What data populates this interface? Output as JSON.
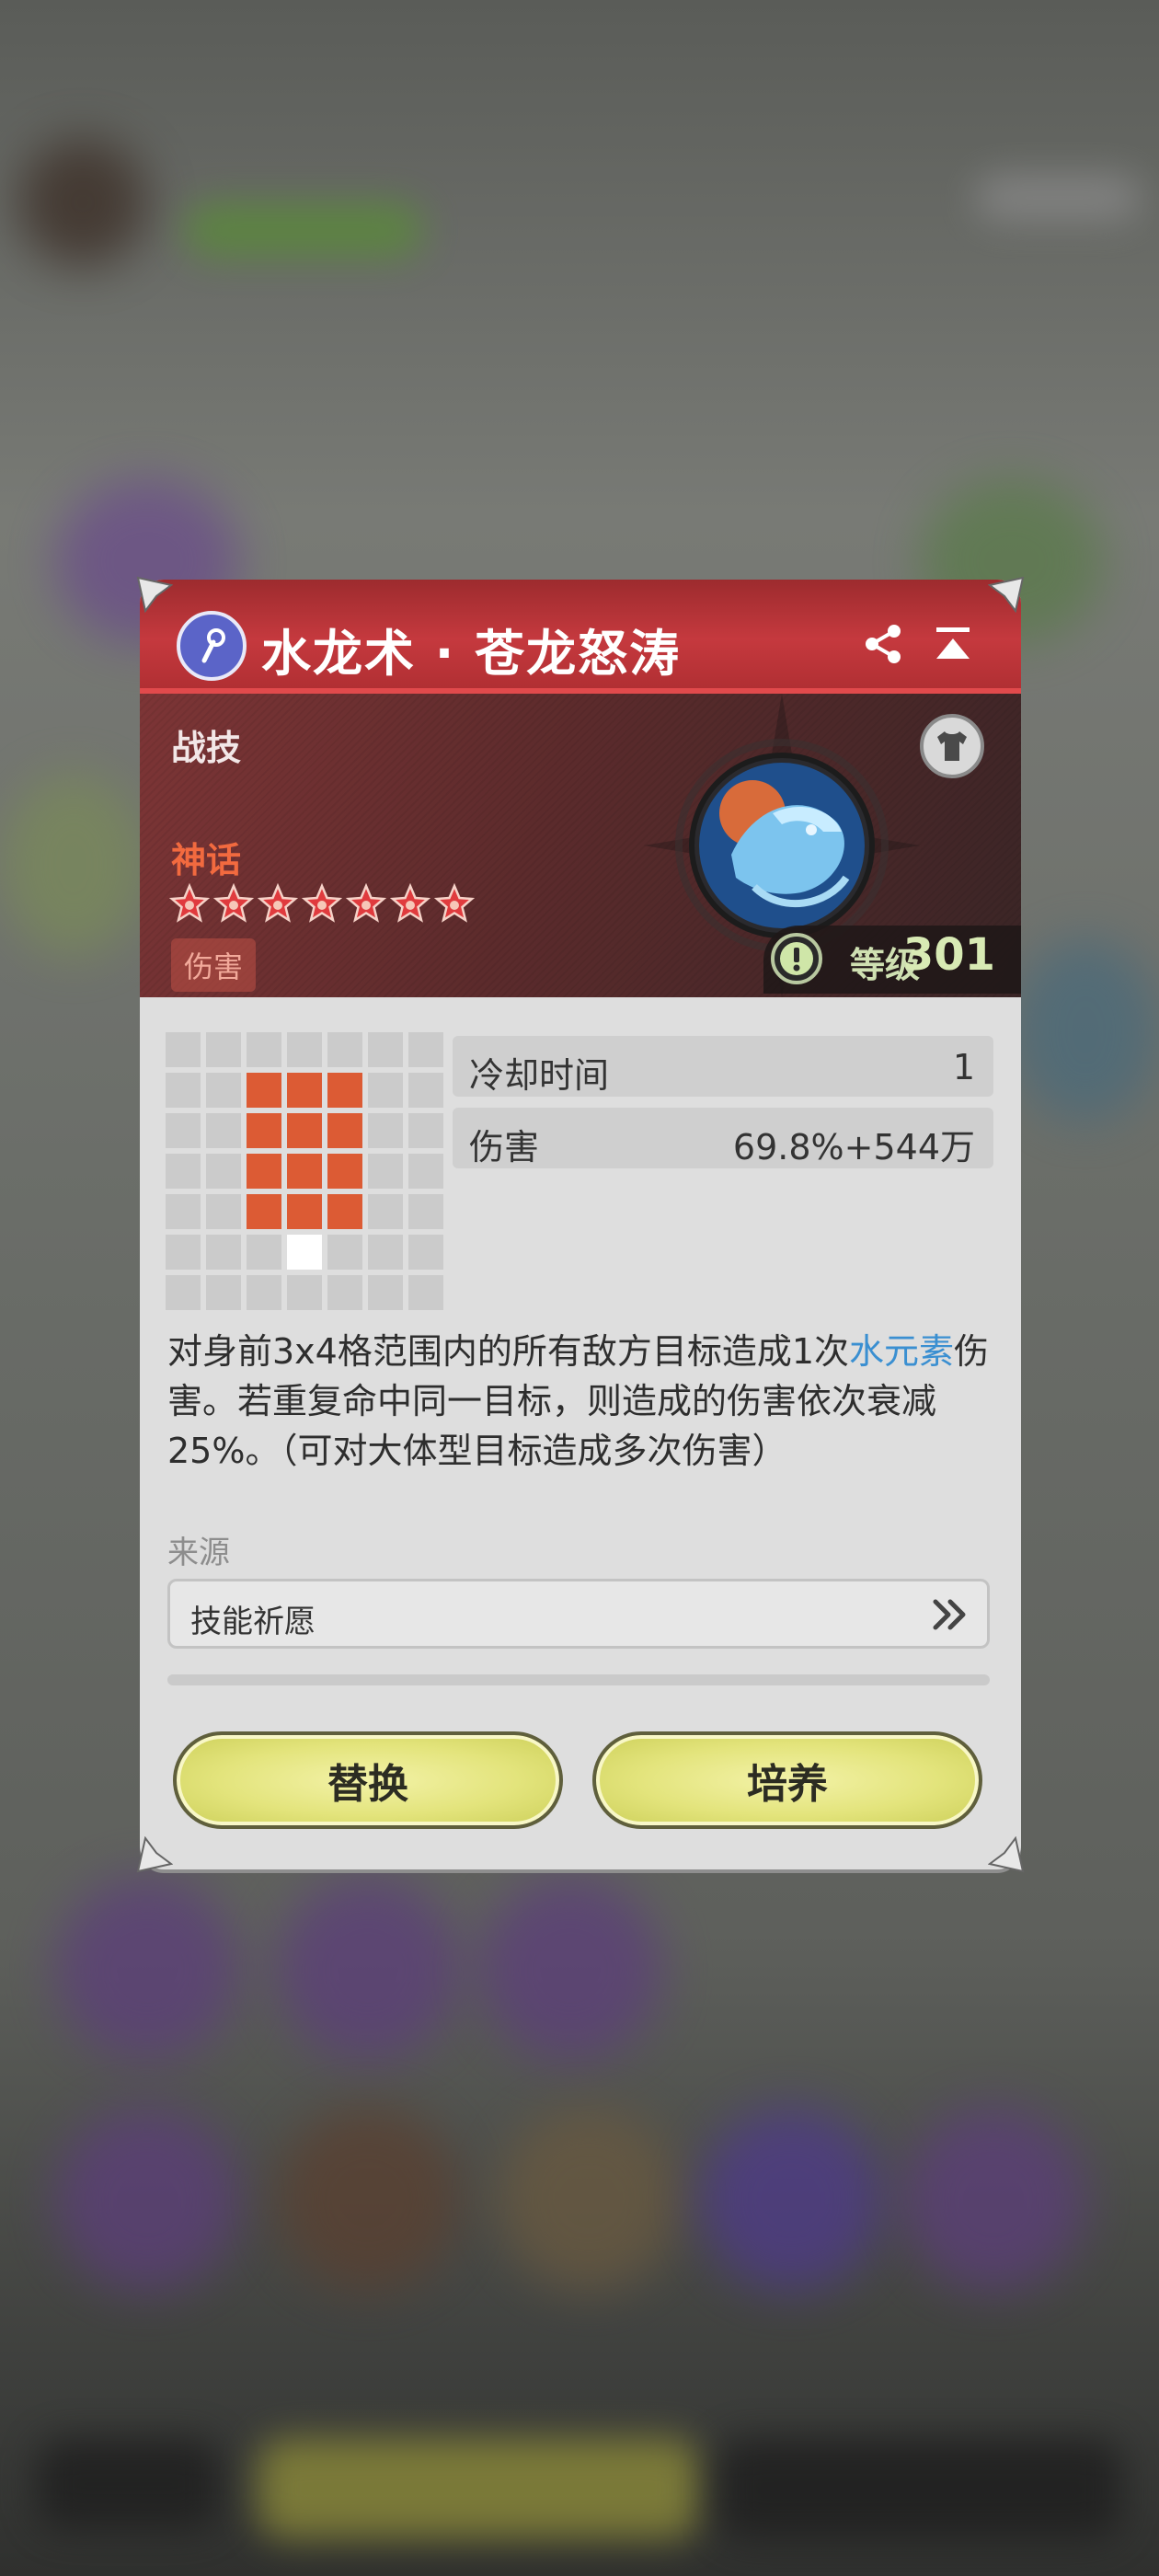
{
  "skill": {
    "name": "水龙术 · 苍龙怒涛",
    "type": "战技",
    "rarity": "神话",
    "stars": 7,
    "tag": "伤害",
    "level_label": "等级",
    "level_value": "301"
  },
  "stats": [
    {
      "label": "冷却时间",
      "value": "1"
    },
    {
      "label": "伤害",
      "value": "69.8%+544万"
    }
  ],
  "range_grid": {
    "rows": [
      [
        0,
        0,
        0,
        0,
        0,
        0,
        0
      ],
      [
        0,
        0,
        1,
        1,
        1,
        0,
        0
      ],
      [
        0,
        0,
        1,
        1,
        1,
        0,
        0
      ],
      [
        0,
        0,
        1,
        1,
        1,
        0,
        0
      ],
      [
        0,
        0,
        1,
        1,
        1,
        0,
        0
      ],
      [
        0,
        0,
        0,
        2,
        0,
        0,
        0
      ],
      [
        0,
        0,
        0,
        0,
        0,
        0,
        0
      ]
    ],
    "legend": {
      "0": "empty",
      "1": "hit",
      "2": "self"
    }
  },
  "description": {
    "part1": "对身前3x4格范围内的所有敌方目标造成1次",
    "element": "水元素",
    "part2": "伤害。若重复命中同一目标，则造成的伤害依次衰减25%。（可对大体型目标造成多次伤害）"
  },
  "source": {
    "label": "来源",
    "value": "技能祈愿"
  },
  "buttons": {
    "replace": "替换",
    "train": "培养"
  },
  "icons": {
    "title": "staff-icon",
    "share": "share-icon",
    "collapse": "collapse-icon",
    "skin": "shirt-icon",
    "warning": "exclamation-icon",
    "source_more": "double-chevron-right-icon"
  },
  "colors": {
    "title_bar": "#c5393e",
    "rarity": "#f26a3f",
    "hit_cell": "#dc5b34",
    "element_highlight": "#3a8fd1",
    "button": "#e3e47c"
  }
}
